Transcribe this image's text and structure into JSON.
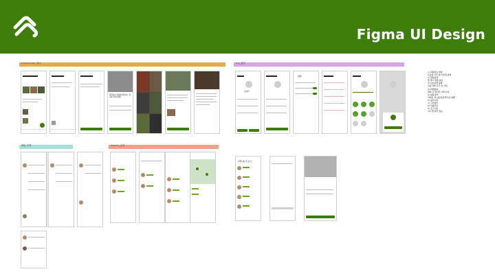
{
  "header": {
    "title": "Figma UI Design",
    "brand_color": "#3f7d0a",
    "logo_icon": "leaf-logo-icon"
  },
  "boards": [
    {
      "label": "Community_게시",
      "color": "#e8a94a"
    },
    {
      "label": "my_설정",
      "color": "#d6a6e8"
    },
    {
      "label": "채팅_목록",
      "color": "#a8e0dc"
    },
    {
      "label": "Search_검색",
      "color": "#f2a08a"
    }
  ],
  "screens": {
    "profile_name": "김더인",
    "modal_title": "회원님의 계정에 해당하는 정보를 입력하세요",
    "write_title": "커뮤니티 글 쓰기",
    "settings_title": "설정"
  },
  "notes": [
    "1) 회원정보 변경",
    "프로필 사진 및 닉네임 변경",
    "2) 알림설정",
    "앱 푸시 알림 설정",
    "3) 관심식물 등록",
    "관심 식물 추가 및 삭제",
    "4) 회원탈퇴",
    "탈퇴 시 데이터 삭제 안내",
    "5) 활동내역",
    "작성한 게시글/댓글/좋아요 목록",
    "6) 공지사항",
    "7) 고객센터",
    "8) 이용약관",
    "9) 로그아웃",
    "10) 앱 버전 정보"
  ]
}
